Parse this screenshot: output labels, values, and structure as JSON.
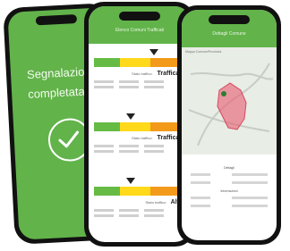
{
  "back_screen": {
    "message_line1": "Segnalazione",
    "message_line2": "completata"
  },
  "middle_screen": {
    "header_title": "Elenco Comuni Trafficati",
    "cards": [
      {
        "level_label": "Stato traffico:",
        "level_value": "Trafficato"
      },
      {
        "level_label": "Stato traffico:",
        "level_value": "Trafficato"
      },
      {
        "level_label": "Stato traffico:",
        "level_value": "Altro"
      }
    ]
  },
  "front_screen": {
    "header_title": "Dettagli Comune",
    "map_label": "Mappa Comune/Provincia",
    "section_title_1": "Dettagli",
    "section_title_2": "Informazioni"
  },
  "colors": {
    "brand_green": "#62b34a",
    "meter_green": "#66bb44",
    "meter_yellow": "#ffd91a",
    "meter_orange": "#f39a1a",
    "region_red": "#e8667a"
  }
}
